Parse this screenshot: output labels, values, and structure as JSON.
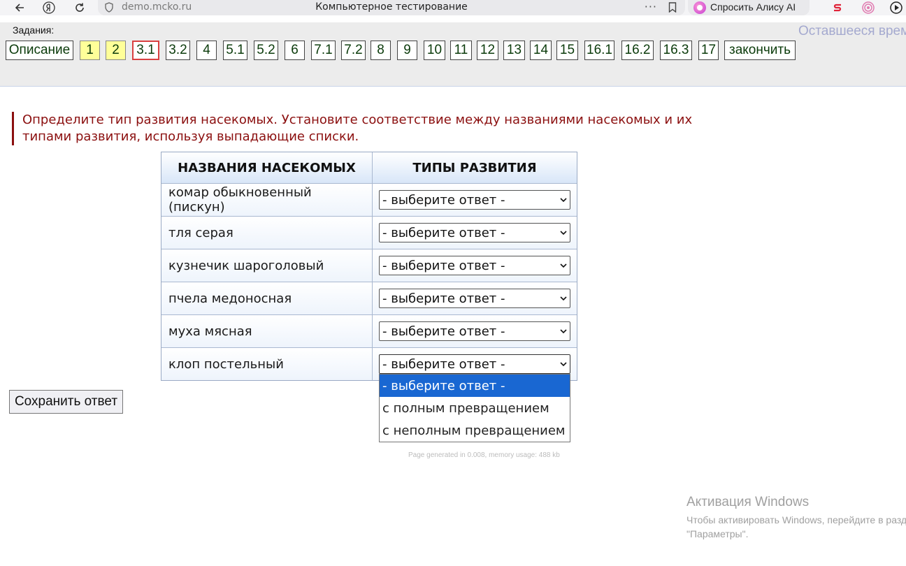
{
  "browser": {
    "url": "demo.mcko.ru",
    "title": "Компьютерное тестирование",
    "dots": "···",
    "alice_label": "Спросить Алису AI"
  },
  "header": {
    "tasks_label": "Задания:",
    "time_left": "Оставшееся врем",
    "tasks": [
      {
        "label": "Описание",
        "state": "normal"
      },
      {
        "label": "1",
        "state": "done"
      },
      {
        "label": "2",
        "state": "done"
      },
      {
        "label": "3.1",
        "state": "current"
      },
      {
        "label": "3.2",
        "state": "normal"
      },
      {
        "label": "4",
        "state": "normal"
      },
      {
        "label": "5.1",
        "state": "normal"
      },
      {
        "label": "5.2",
        "state": "normal"
      },
      {
        "label": "6",
        "state": "normal"
      },
      {
        "label": "7.1",
        "state": "normal"
      },
      {
        "label": "7.2",
        "state": "normal"
      },
      {
        "label": "8",
        "state": "normal"
      },
      {
        "label": "9",
        "state": "normal"
      },
      {
        "label": "10",
        "state": "normal"
      },
      {
        "label": "11",
        "state": "normal"
      },
      {
        "label": "12",
        "state": "normal"
      },
      {
        "label": "13",
        "state": "normal"
      },
      {
        "label": "14",
        "state": "normal"
      },
      {
        "label": "15",
        "state": "normal"
      },
      {
        "label": "16.1",
        "state": "normal"
      },
      {
        "label": "16.2",
        "state": "normal"
      },
      {
        "label": "16.3",
        "state": "normal"
      },
      {
        "label": "17",
        "state": "normal"
      },
      {
        "label": "закончить",
        "state": "normal"
      }
    ]
  },
  "question": {
    "text": "Определите тип развития насекомых. Установите соответствие между названиями насекомых и их типами развития, используя выпадающие списки."
  },
  "table": {
    "col1": "НАЗВАНИЯ НАСЕКОМЫХ",
    "col2": "ТИПЫ РАЗВИТИЯ",
    "rows": [
      {
        "name": "комар обыкновенный (пискун)",
        "value": "- выберите ответ -"
      },
      {
        "name": "тля серая",
        "value": "- выберите ответ -"
      },
      {
        "name": "кузнечик шароголовый",
        "value": "- выберите ответ -"
      },
      {
        "name": "пчела медоносная",
        "value": "- выберите ответ -"
      },
      {
        "name": "муха мясная",
        "value": "- выберите ответ -"
      },
      {
        "name": "клоп постельный",
        "value": "- выберите ответ -"
      }
    ]
  },
  "dropdown": {
    "options": [
      "- выберите ответ -",
      "с полным превращением",
      "с неполным превращением"
    ],
    "highlighted": 0
  },
  "save_button": "Сохранить ответ",
  "footer_note": "Page generated in 0.008, memory usage: 488 kb",
  "windows": {
    "title": "Активация Windows",
    "line1": "Чтобы активировать Windows, перейдите в раздел",
    "line2": "\"Параметры\"."
  },
  "colors": {
    "accent_highlight": "#1967d2",
    "question_text": "#8b0f0f",
    "done_task": "#ffff99",
    "current_border": "#d94040"
  }
}
